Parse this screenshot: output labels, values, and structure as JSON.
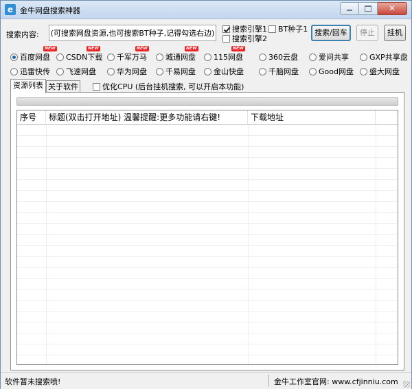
{
  "window": {
    "title": "金牛网盘搜索神器",
    "app_icon_glyph": "e",
    "close_glyph": "✕"
  },
  "search": {
    "label": "搜索内容:",
    "value": "(可搜索网盘资源,也可搜索BT种子,记得勾选右边)",
    "engine1": {
      "label": "搜索引擎1",
      "checked": true
    },
    "engine2": {
      "label": "搜索引擎2",
      "checked": false
    },
    "bt": {
      "label": "BT种子1",
      "checked": false
    },
    "search_button": "搜索/回车",
    "stop_button": "停止",
    "hangup_button": "挂机"
  },
  "sources": [
    {
      "label": "百度网盘",
      "selected": true,
      "is_new": true
    },
    {
      "label": "CSDN下载",
      "selected": false,
      "is_new": true
    },
    {
      "label": "千军万马",
      "selected": false,
      "is_new": true
    },
    {
      "label": "城通网盘",
      "selected": false,
      "is_new": true
    },
    {
      "label": "115网盘",
      "selected": false,
      "is_new": true
    },
    {
      "label": "360云盘",
      "selected": false,
      "is_new": false
    },
    {
      "label": "爱问共享",
      "selected": false,
      "is_new": false
    },
    {
      "label": "GXP共享盘",
      "selected": false,
      "is_new": false
    },
    {
      "label": "迅雷快传",
      "selected": false,
      "is_new": false
    },
    {
      "label": "飞速网盘",
      "selected": false,
      "is_new": false
    },
    {
      "label": "华为网盘",
      "selected": false,
      "is_new": false
    },
    {
      "label": "千易网盘",
      "selected": false,
      "is_new": false
    },
    {
      "label": "金山快盘",
      "selected": false,
      "is_new": false
    },
    {
      "label": "千脑网盘",
      "selected": false,
      "is_new": false
    },
    {
      "label": "Good网盘",
      "selected": false,
      "is_new": false
    },
    {
      "label": "盛大网盘",
      "selected": false,
      "is_new": false
    }
  ],
  "new_badge": "NEW",
  "tabs": [
    {
      "label": "资源列表",
      "active": true
    },
    {
      "label": "关于软件",
      "active": false
    }
  ],
  "optimize_cpu": {
    "label": "优化CPU (后台挂机搜索, 可以开启本功能)",
    "checked": false
  },
  "table": {
    "columns": [
      "序号",
      "标题(双击打开地址) 温馨提醒:更多功能请右键!",
      "下载地址"
    ],
    "rows": []
  },
  "status": {
    "left": "软件暂未搜索喷!",
    "right": "金牛工作室官网: www.cfjinniu.com"
  },
  "colors": {
    "accent": "#3c7fb1",
    "radio_dot": "#1b64b8",
    "new_badge": "#e22222"
  }
}
